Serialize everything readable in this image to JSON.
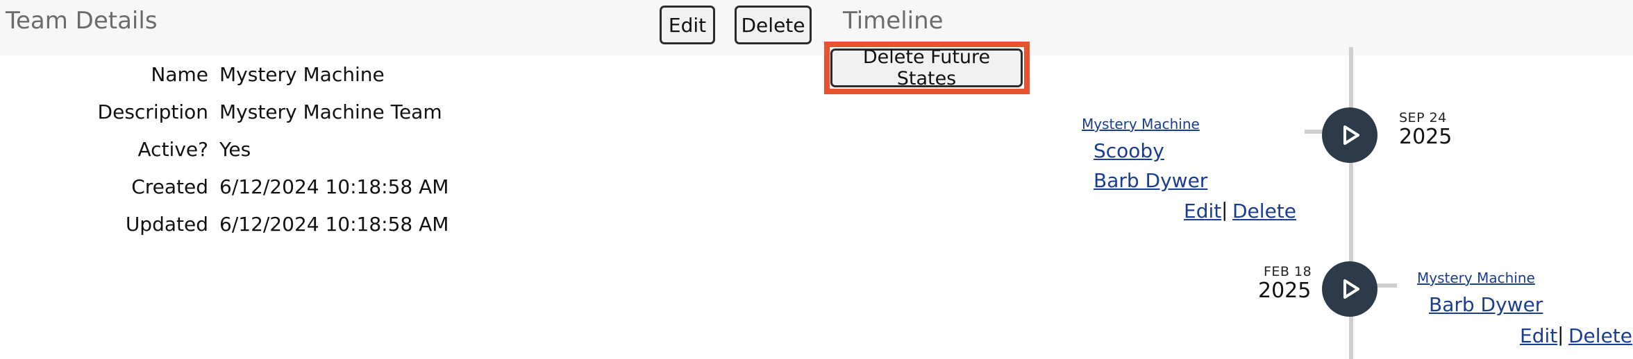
{
  "details": {
    "title": "Team Details",
    "edit_label": "Edit",
    "delete_label": "Delete",
    "fields": [
      {
        "label": "Name",
        "value": "Mystery Machine"
      },
      {
        "label": "Description",
        "value": "Mystery Machine Team"
      },
      {
        "label": "Active?",
        "value": "Yes"
      },
      {
        "label": "Created",
        "value": "6/12/2024 10:18:58 AM"
      },
      {
        "label": "Updated",
        "value": "6/12/2024 10:18:58 AM"
      }
    ]
  },
  "timeline": {
    "title": "Timeline",
    "delete_future_label": "Delete Future States",
    "highlight_color": "#e8532f",
    "node_color": "#2d3a4a",
    "entries": [
      {
        "month_day": "SEP 24",
        "year": "2025",
        "team": "Mystery Machine",
        "members": [
          "Scooby",
          "Barb Dywer"
        ],
        "edit_label": "Edit",
        "separator": "|",
        "delete_label": "Delete"
      },
      {
        "month_day": "FEB 18",
        "year": "2025",
        "team": "Mystery Machine",
        "members": [
          "Barb Dywer"
        ],
        "edit_label": "Edit",
        "separator": "|",
        "delete_label": "Delete"
      }
    ]
  }
}
